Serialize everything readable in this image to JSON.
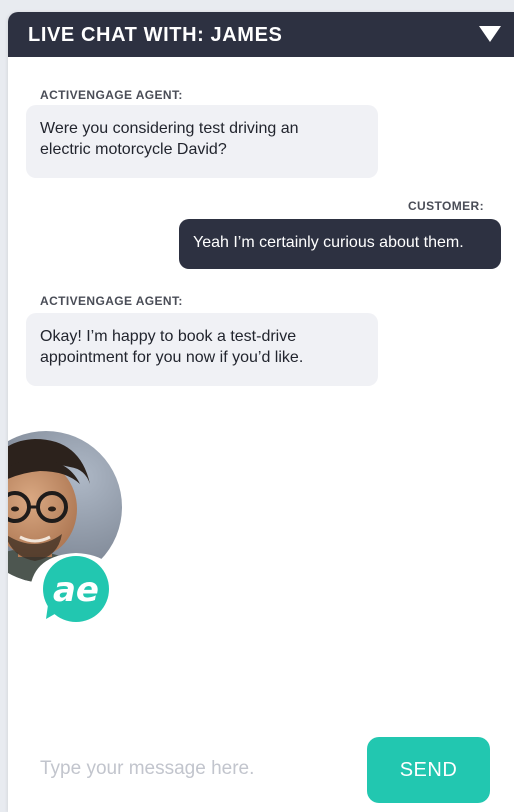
{
  "header": {
    "title": "LIVE CHAT WITH: JAMES",
    "toggle_icon": "caret-down-icon"
  },
  "messages": [
    {
      "sender": "ACTIVENGAGE AGENT:",
      "role": "agent",
      "text_lines": [
        "Were you considering test driving an",
        "electric motorcycle David?"
      ]
    },
    {
      "sender": "CUSTOMER:",
      "role": "customer",
      "text_lines": [
        "Yeah I’m certainly curious about them."
      ]
    },
    {
      "sender": "ACTIVENGAGE AGENT:",
      "role": "agent",
      "text_lines": [
        "Okay! I’m happy to book a test-drive",
        "appointment for you now if you’d like."
      ]
    }
  ],
  "agent_avatar": {
    "badge_text": "ae",
    "badge_icon": "activengage-logo-icon"
  },
  "composer": {
    "placeholder": "Type your message here.",
    "value": "",
    "send_label": "SEND"
  },
  "colors": {
    "header_bg": "#2d3141",
    "agent_bubble": "#f0f1f5",
    "customer_bubble": "#2d3141",
    "accent": "#22c7b0"
  }
}
